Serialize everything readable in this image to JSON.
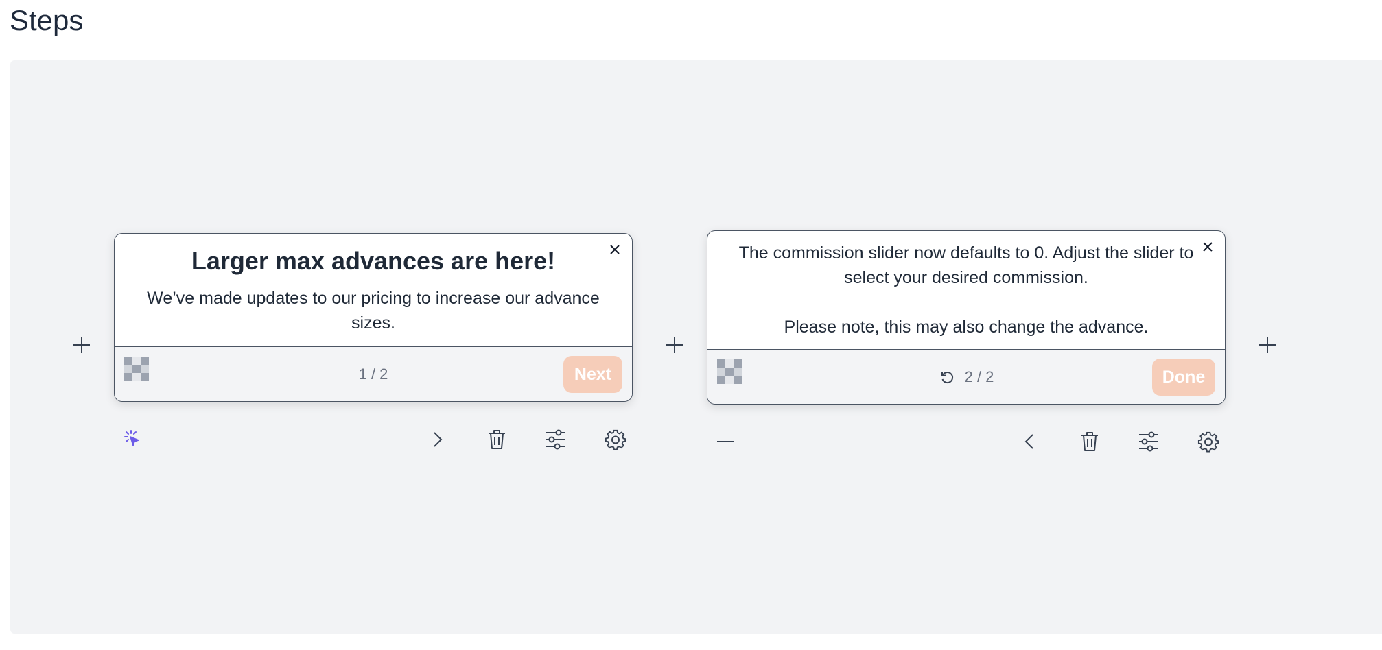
{
  "page": {
    "title": "Steps"
  },
  "steps": [
    {
      "title": "Larger max advances are here!",
      "text": "We’ve made updates to our pricing to increase our advance sizes.",
      "counter": "1 / 2",
      "button_label": "Next"
    },
    {
      "text_line1": "The commission slider now defaults to 0. Adjust the slider to select your desired commission.",
      "text_line2": "Please note, this may also change the advance.",
      "counter": "2 / 2",
      "button_label": "Done"
    }
  ],
  "icons": {
    "add": "plus-icon",
    "close": "close-icon",
    "click_trigger": "cursor-click-icon",
    "next": "chevron-right-icon",
    "prev": "chevron-left-icon",
    "delete": "trash-icon",
    "adjust": "sliders-icon",
    "settings": "gear-icon",
    "collapse": "minus-icon",
    "restart": "restart-icon"
  },
  "colors": {
    "accent_button": "#f6cdb9",
    "trigger_icon": "#6d5ce8",
    "canvas_bg": "#f2f3f5"
  }
}
